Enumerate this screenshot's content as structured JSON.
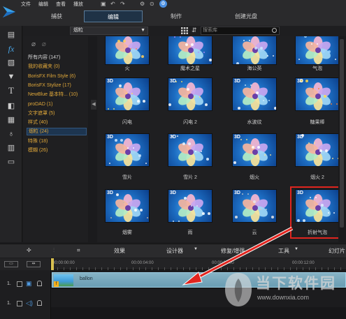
{
  "menu": [
    "文件",
    "编辑",
    "查看",
    "播放"
  ],
  "quick_access": {
    "notify_icon": "notification-icon",
    "notify_glyph": "⚙"
  },
  "modes": [
    {
      "label": "捕获",
      "active": false
    },
    {
      "label": "编辑",
      "active": true
    },
    {
      "label": "制作",
      "active": false
    },
    {
      "label": "创建光盘",
      "active": false
    }
  ],
  "rail_icons": [
    "media-room-icon",
    "fx-room-icon",
    "pip-room-icon",
    "particle-room-icon",
    "title-room-icon",
    "transition-room-icon",
    "audio-mix-icon",
    "voice-over-icon",
    "chapter-icon",
    "subtitle-icon"
  ],
  "library": {
    "category_selected": "烟粒",
    "search_placeholder": "搜索库"
  },
  "categories": [
    {
      "label": "所有内容 (147)",
      "style": "white"
    },
    {
      "label": "我的收藏夹 (0)",
      "style": "orange"
    },
    {
      "label": "BorisFX Film Style (6)",
      "style": "orange"
    },
    {
      "label": "BorisFX Stylize (17)",
      "style": "orange"
    },
    {
      "label": "NewBlue 基本特... (10)",
      "style": "orange"
    },
    {
      "label": "proDAD (1)",
      "style": "orange"
    },
    {
      "label": "文字遮罩 (5)",
      "style": "orange"
    },
    {
      "label": "样式 (40)",
      "style": "orange"
    },
    {
      "label": "烟粒 (24)",
      "style": "selected"
    },
    {
      "label": "特殊 (18)",
      "style": "orange"
    },
    {
      "label": "模糊 (26)",
      "style": "orange"
    }
  ],
  "effects": [
    {
      "label": "火",
      "is3d": false
    },
    {
      "label": "魔术之星",
      "is3d": false
    },
    {
      "label": "海公英",
      "is3d": false
    },
    {
      "label": "气泡",
      "is3d": false
    },
    {
      "label": "闪电",
      "is3d": true
    },
    {
      "label": "闪电 2",
      "is3d": true
    },
    {
      "label": "水波纹",
      "is3d": true
    },
    {
      "label": "糖果棒",
      "is3d": true
    },
    {
      "label": "雪片",
      "is3d": true
    },
    {
      "label": "雪片 2",
      "is3d": true
    },
    {
      "label": "烟火",
      "is3d": true
    },
    {
      "label": "烟火 2",
      "is3d": true
    },
    {
      "label": "烟雾",
      "is3d": true
    },
    {
      "label": "雨",
      "is3d": true
    },
    {
      "label": "云",
      "is3d": true
    },
    {
      "label": "折射气泡",
      "is3d": true
    }
  ],
  "badge_3d": "3D",
  "timeline_toolbar": {
    "effects": "效果",
    "designer": "设计器",
    "trim": "修复/增强",
    "tools": "工具",
    "slideshow": "幻灯片"
  },
  "ruler": [
    "00:00:00:00",
    "00:00:04:00",
    "00:00:08:00",
    "00:00:12:00"
  ],
  "tracks": [
    {
      "num": "1.",
      "type": "video",
      "clip": "ballon"
    },
    {
      "num": "1.",
      "type": "audio",
      "clip": ""
    }
  ],
  "watermark": {
    "title": "当下软件园",
    "url": "www.downxia.com"
  },
  "colors": {
    "accent": "#1f3246",
    "selection": "#e0251f",
    "category_text": "#e0a83a",
    "clip": "#86b3c5"
  }
}
